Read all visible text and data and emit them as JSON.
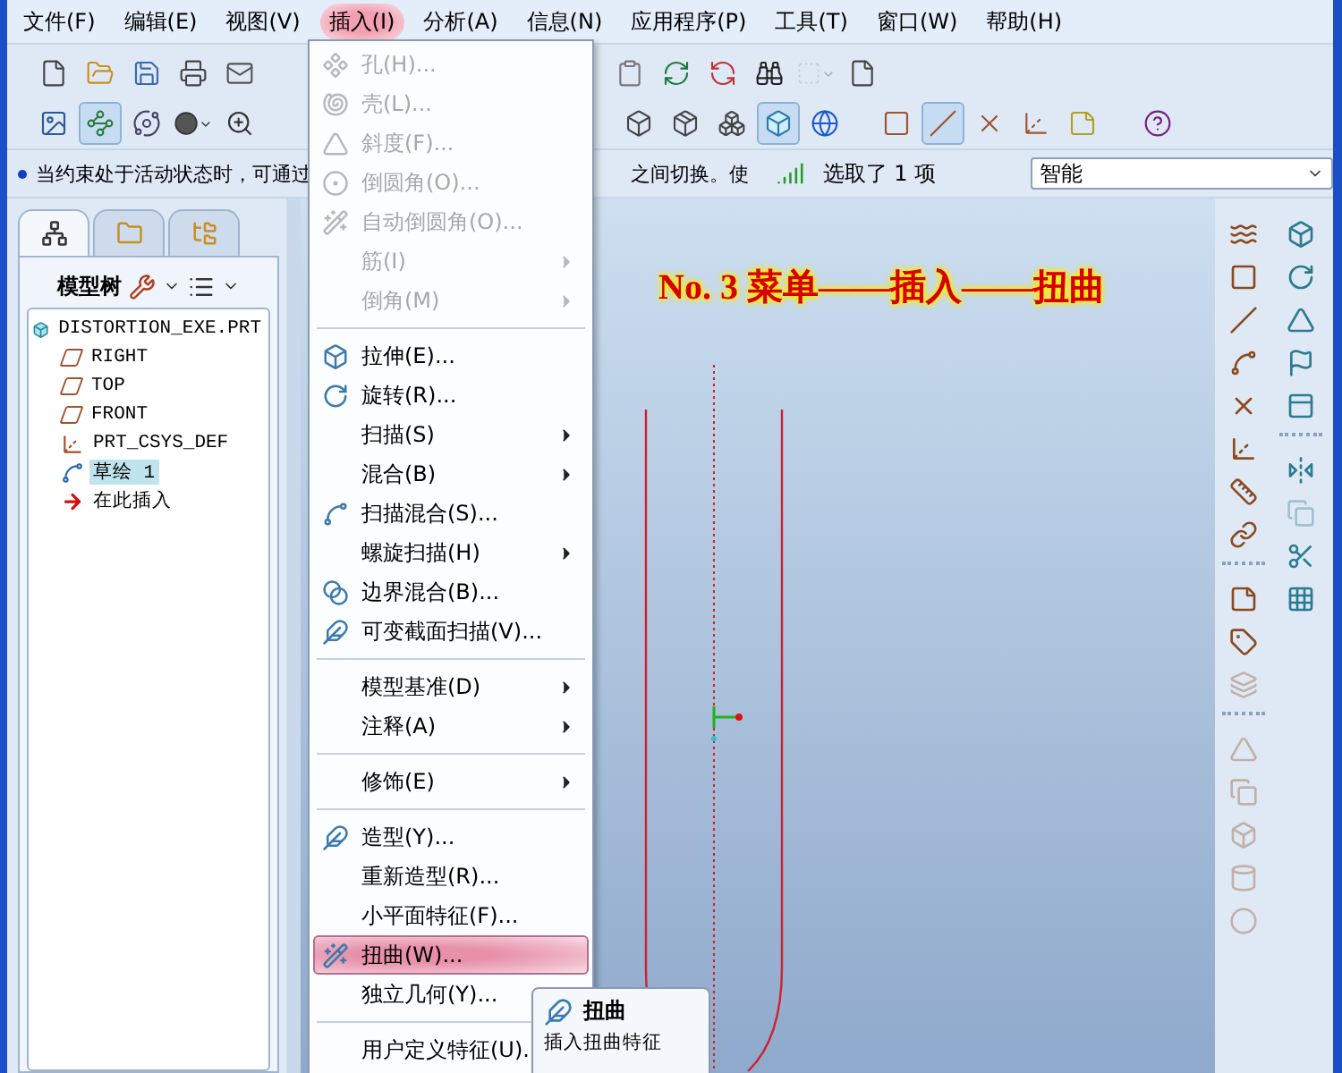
{
  "menu_bar": [
    {
      "label": "文件(F)",
      "selected": false
    },
    {
      "label": "编辑(E)",
      "selected": false
    },
    {
      "label": "视图(V)",
      "selected": false
    },
    {
      "label": "插入(I)",
      "selected": true
    },
    {
      "label": "分析(A)",
      "selected": false
    },
    {
      "label": "信息(N)",
      "selected": false
    },
    {
      "label": "应用程序(P)",
      "selected": false
    },
    {
      "label": "工具(T)",
      "selected": false
    },
    {
      "label": "窗口(W)",
      "selected": false
    },
    {
      "label": "帮助(H)",
      "selected": false
    }
  ],
  "toolbar": {
    "row_1": [
      {
        "pressed": false
      },
      {
        "pressed": false
      },
      {
        "pressed": false
      },
      {
        "pressed": false
      },
      {
        "pressed": false
      },
      {
        "pressed": false
      },
      {
        "pressed": false
      },
      {
        "pressed": false
      },
      {
        "pressed": false
      },
      {
        "pressed": false
      },
      {
        "pressed": false
      }
    ],
    "row_2": [
      {
        "pressed": false
      },
      {
        "pressed": true
      },
      {
        "pressed": false
      },
      {
        "pressed": false
      },
      {
        "pressed": false
      },
      {
        "pressed": false
      },
      {
        "pressed": false
      },
      {
        "pressed": false
      },
      {
        "pressed": true
      },
      {
        "pressed": false
      },
      {
        "pressed": false
      },
      {
        "pressed": true
      },
      {
        "pressed": false
      },
      {
        "pressed": false
      },
      {
        "pressed": false
      },
      {
        "pressed": false
      }
    ]
  },
  "status": {
    "message_parts": [
      "当约束处于活动状态时，可通过",
      "之间切换。使"
    ],
    "selection_text": "选取了 1 项",
    "filter": {
      "value": "智能"
    }
  },
  "model_tree": {
    "tabs": [
      {
        "selected": true
      },
      {
        "selected": false
      },
      {
        "selected": false
      }
    ],
    "title": "模型树",
    "root": {
      "label": "DISTORTION_EXE.PRT",
      "children": [
        {
          "label": "RIGHT",
          "kind": "plane",
          "selected": false
        },
        {
          "label": "TOP",
          "kind": "plane",
          "selected": false
        },
        {
          "label": "FRONT",
          "kind": "plane",
          "selected": false
        },
        {
          "label": "PRT_CSYS_DEF",
          "kind": "csys",
          "selected": false
        },
        {
          "label": "草绘 1",
          "kind": "sketch",
          "selected": true
        },
        {
          "label": "在此插入",
          "kind": "insert",
          "selected": false
        }
      ]
    }
  },
  "canvas": {
    "caption": "No. 3 菜单——插入——扭曲"
  },
  "right_toolbar": {
    "column_1": [
      [
        {
          "disabled": false
        },
        {
          "disabled": false
        },
        {
          "disabled": false
        },
        {
          "disabled": false
        },
        {
          "disabled": false
        },
        {
          "disabled": false
        },
        {
          "disabled": false
        },
        {
          "disabled": false
        }
      ],
      [
        {
          "disabled": false
        },
        {
          "disabled": false
        },
        {
          "disabled": true
        }
      ],
      [
        {
          "disabled": true
        },
        {
          "disabled": true
        },
        {
          "disabled": true
        },
        {
          "disabled": true
        },
        {
          "disabled": true
        }
      ]
    ],
    "column_2": [
      [
        {
          "disabled": false
        },
        {
          "disabled": false
        },
        {
          "disabled": false
        },
        {
          "disabled": false
        },
        {
          "disabled": false
        }
      ],
      [
        {
          "disabled": false
        },
        {
          "disabled": true
        },
        {
          "disabled": false
        },
        {
          "disabled": false
        }
      ]
    ]
  },
  "insert_menu": {
    "groups": [
      [
        {
          "label": "孔(H)...",
          "disabled": true,
          "submenu": false,
          "has_icon": true,
          "selected": false
        },
        {
          "label": "壳(L)...",
          "disabled": true,
          "submenu": false,
          "has_icon": true,
          "selected": false
        },
        {
          "label": "斜度(F)...",
          "disabled": true,
          "submenu": false,
          "has_icon": true,
          "selected": false
        },
        {
          "label": "倒圆角(O)...",
          "disabled": true,
          "submenu": false,
          "has_icon": true,
          "selected": false
        },
        {
          "label": "自动倒圆角(O)...",
          "disabled": true,
          "submenu": false,
          "has_icon": true,
          "selected": false
        },
        {
          "label": "筋(I)",
          "disabled": true,
          "submenu": true,
          "has_icon": false,
          "selected": false
        },
        {
          "label": "倒角(M)",
          "disabled": true,
          "submenu": true,
          "has_icon": false,
          "selected": false
        }
      ],
      [
        {
          "label": "拉伸(E)...",
          "disabled": false,
          "submenu": false,
          "has_icon": true,
          "selected": false
        },
        {
          "label": "旋转(R)...",
          "disabled": false,
          "submenu": false,
          "has_icon": true,
          "selected": false
        },
        {
          "label": "扫描(S)",
          "disabled": false,
          "submenu": true,
          "has_icon": false,
          "selected": false
        },
        {
          "label": "混合(B)",
          "disabled": false,
          "submenu": true,
          "has_icon": false,
          "selected": false
        },
        {
          "label": "扫描混合(S)...",
          "disabled": false,
          "submenu": false,
          "has_icon": true,
          "selected": false
        },
        {
          "label": "螺旋扫描(H)",
          "disabled": false,
          "submenu": true,
          "has_icon": false,
          "selected": false
        },
        {
          "label": "边界混合(B)...",
          "disabled": false,
          "submenu": false,
          "has_icon": true,
          "selected": false
        },
        {
          "label": "可变截面扫描(V)...",
          "disabled": false,
          "submenu": false,
          "has_icon": true,
          "selected": false
        }
      ],
      [
        {
          "label": "模型基准(D)",
          "disabled": false,
          "submenu": true,
          "has_icon": false,
          "selected": false
        },
        {
          "label": "注释(A)",
          "disabled": false,
          "submenu": true,
          "has_icon": false,
          "selected": false
        }
      ],
      [
        {
          "label": "修饰(E)",
          "disabled": false,
          "submenu": true,
          "has_icon": false,
          "selected": false
        }
      ],
      [
        {
          "label": "造型(Y)...",
          "disabled": false,
          "submenu": false,
          "has_icon": true,
          "selected": false
        },
        {
          "label": "重新造型(R)...",
          "disabled": false,
          "submenu": false,
          "has_icon": false,
          "selected": false
        },
        {
          "label": "小平面特征(F)...",
          "disabled": false,
          "submenu": false,
          "has_icon": false,
          "selected": false
        },
        {
          "label": "扭曲(W)...",
          "disabled": false,
          "submenu": false,
          "has_icon": true,
          "selected": true
        },
        {
          "label": "独立几何(Y)...",
          "disabled": false,
          "has_icon": false,
          "selected": false
        }
      ],
      [
        {
          "label": "用户定义特征(U)...",
          "disabled": false,
          "has_icon": false,
          "selected": false
        }
      ]
    ]
  },
  "tooltip": {
    "title": "扭曲",
    "description": "插入扭曲特征"
  }
}
